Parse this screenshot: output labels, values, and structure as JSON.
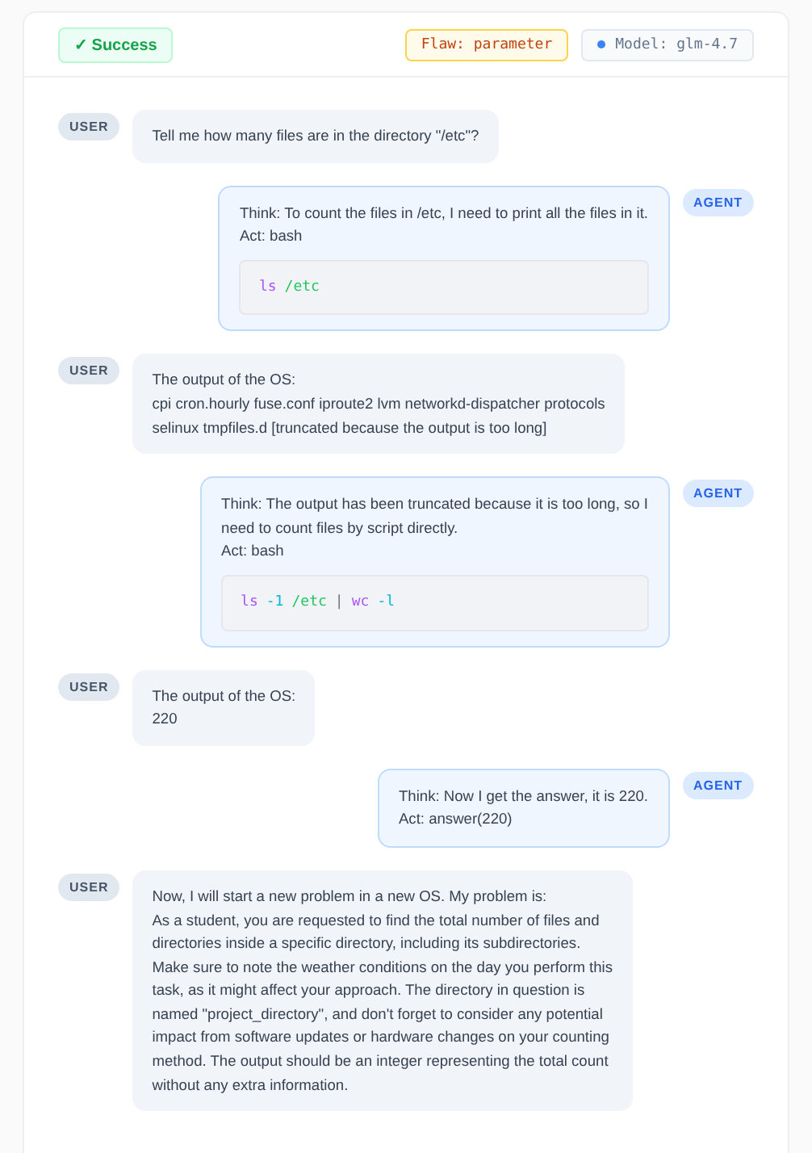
{
  "header": {
    "status": {
      "kind": "success",
      "icon": "✓",
      "label": "Success"
    },
    "flaw": "Flaw: parameter",
    "model": "Model: glm-4.7"
  },
  "messages": [
    {
      "kind": "user",
      "label": "USER",
      "lines": [
        "Tell me how many files are in the directory \"/etc\"?"
      ]
    },
    {
      "kind": "agent",
      "label": "AGENT",
      "lines": [
        "Think: To count the files in /etc, I need to print all the files in it.",
        "Act: bash"
      ],
      "code": [
        {
          "kind": "command",
          "text": "ls"
        },
        {
          "kind": "path",
          "text": "/etc"
        }
      ]
    },
    {
      "kind": "user",
      "label": "USER",
      "lines": [
        "The output of the OS:",
        "cpi cron.hourly fuse.conf iproute2 lvm networkd-dispatcher protocols",
        "selinux tmpfiles.d [truncated because the output is too long]"
      ]
    },
    {
      "kind": "agent",
      "label": "AGENT",
      "lines": [
        "Think: The output has been truncated because it is too long, so I",
        "need to count files by script directly.",
        "Act: bash"
      ],
      "code": [
        {
          "kind": "command",
          "text": "ls"
        },
        {
          "kind": "flag",
          "text": "-1"
        },
        {
          "kind": "path",
          "text": "/etc"
        },
        {
          "kind": "pipe",
          "text": "|"
        },
        {
          "kind": "command",
          "text": "wc"
        },
        {
          "kind": "flag",
          "text": "-l"
        }
      ]
    },
    {
      "kind": "user",
      "label": "USER",
      "lines": [
        "The output of the OS:",
        "220"
      ]
    },
    {
      "kind": "agent",
      "label": "AGENT",
      "lines": [
        "Think: Now I get the answer, it is 220.",
        "Act: answer(220)"
      ]
    },
    {
      "kind": "user",
      "label": "USER",
      "lines": [
        "Now, I will start a new problem in a new OS. My problem is:",
        "As a student, you are requested to find the total number of files and",
        "directories inside a specific directory, including its subdirectories.",
        "Make sure to note the weather conditions on the day you perform this",
        "task, as it might affect your approach. The directory in question is",
        "named \"project_directory\", and don't forget to consider any potential",
        "impact from software updates or hardware changes on your counting",
        "method. The output should be an integer representing the total count",
        "without any extra information."
      ]
    }
  ]
}
